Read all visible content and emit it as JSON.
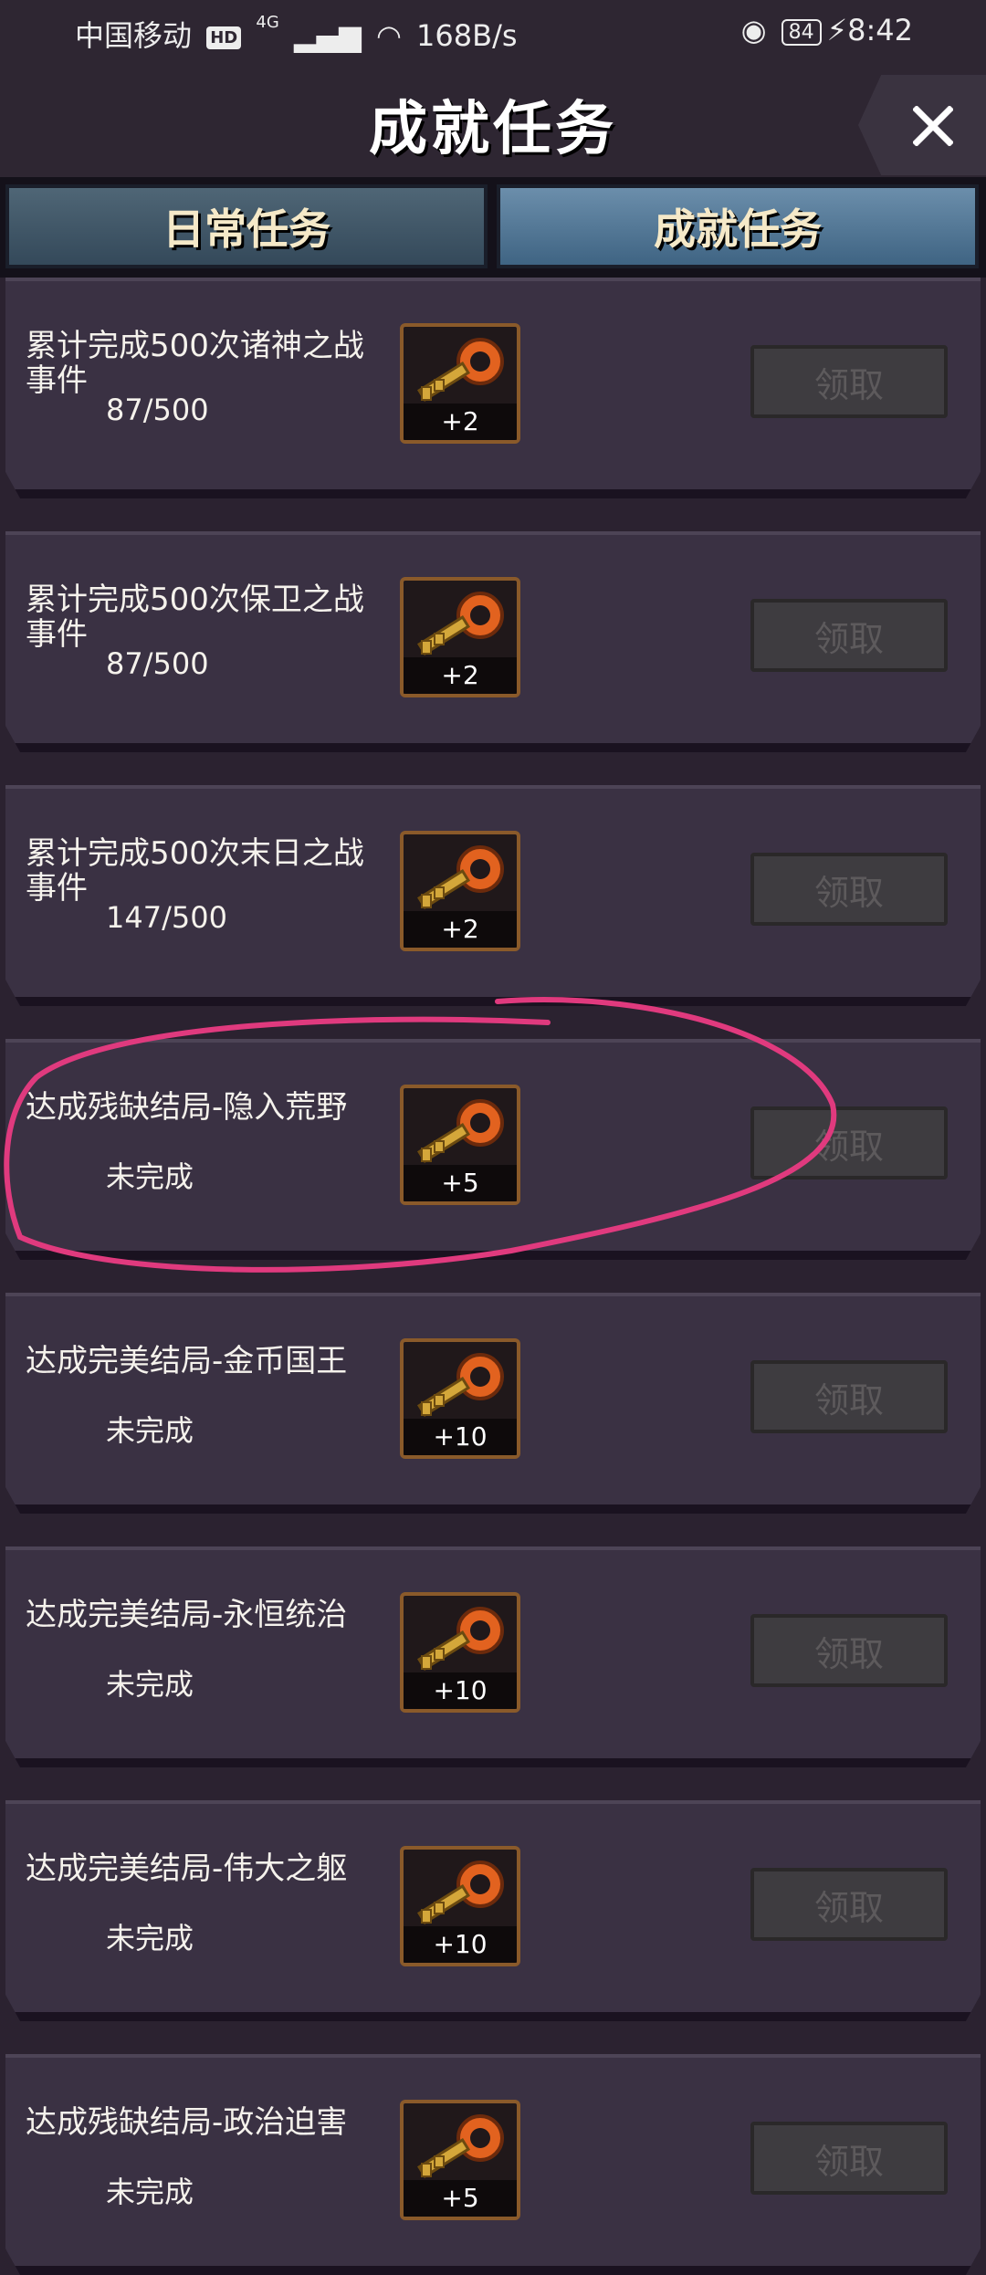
{
  "status_bar": {
    "carrier": "中国移动",
    "hd": "HD",
    "network": "4G",
    "speed": "168B/s",
    "battery": "84",
    "time": "8:42"
  },
  "header": {
    "title": "成就任务",
    "close_icon": "close-icon"
  },
  "tabs": [
    {
      "label": "日常任务"
    },
    {
      "label": "成就任务"
    }
  ],
  "tasks": [
    {
      "title": "累计完成500次诸神之战事件",
      "progress": "87/500",
      "reward": "+2",
      "button": "领取"
    },
    {
      "title": "累计完成500次保卫之战事件",
      "progress": "87/500",
      "reward": "+2",
      "button": "领取"
    },
    {
      "title": "累计完成500次末日之战事件",
      "progress": "147/500",
      "reward": "+2",
      "button": "领取"
    },
    {
      "title": "达成残缺结局-隐入荒野",
      "progress": "未完成",
      "reward": "+5",
      "button": "领取"
    },
    {
      "title": "达成完美结局-金币国王",
      "progress": "未完成",
      "reward": "+10",
      "button": "领取"
    },
    {
      "title": "达成完美结局-永恒统治",
      "progress": "未完成",
      "reward": "+10",
      "button": "领取"
    },
    {
      "title": "达成完美结局-伟大之躯",
      "progress": "未完成",
      "reward": "+10",
      "button": "领取"
    },
    {
      "title": "达成残缺结局-政治迫害",
      "progress": "未完成",
      "reward": "+5",
      "button": "领取"
    }
  ],
  "colors": {
    "annotation": "#e03a7e",
    "tab_active": "#4f7596",
    "claim_disabled": "#3e3c40"
  },
  "reward_icon": "key-icon"
}
